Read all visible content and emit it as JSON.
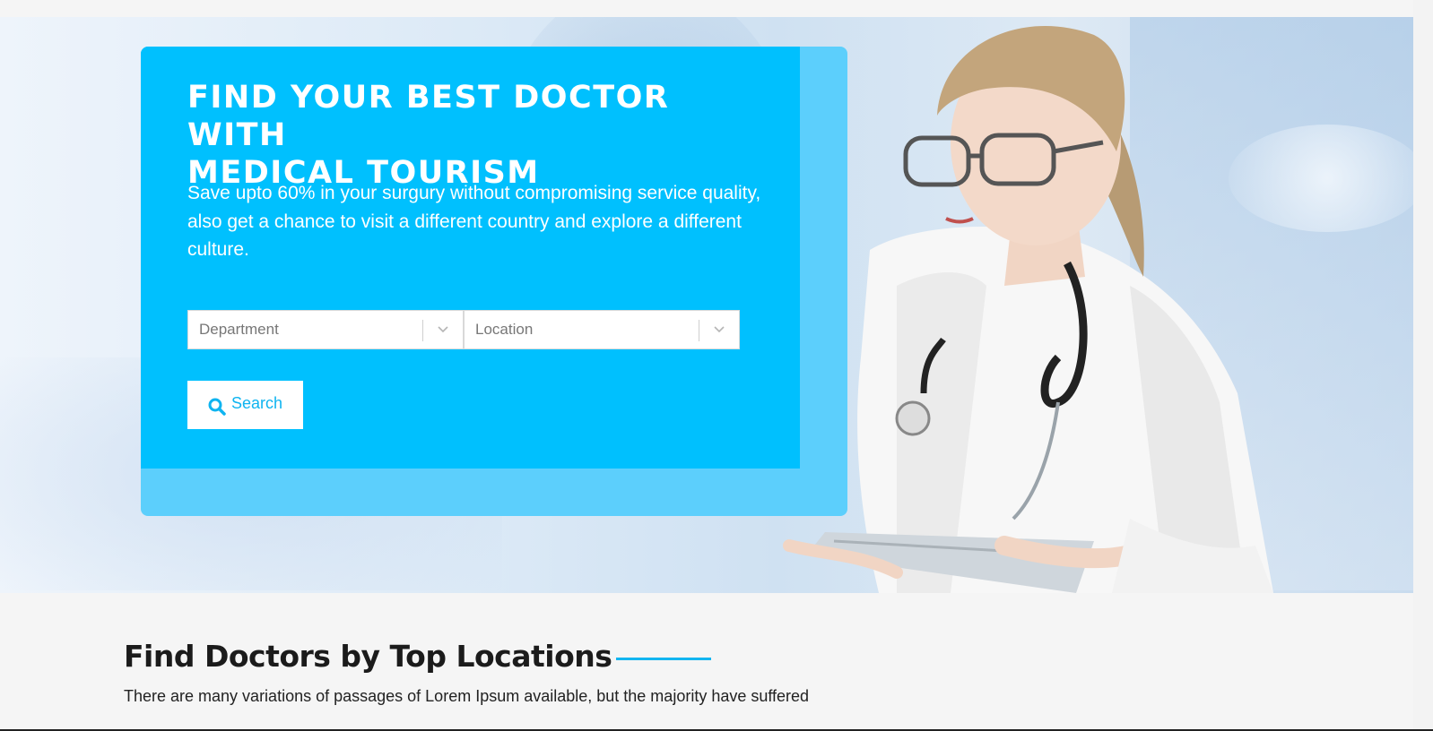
{
  "hero": {
    "headline_line1": "FIND YOUR BEST DOCTOR WITH",
    "headline_line2": "MEDICAL TOURISM",
    "lead_line1": "Save upto 60% in your surgury without compromising service quality,",
    "lead_line2": "also get a chance to visit a different country and explore a different culture.",
    "department_select": {
      "value": "Department",
      "icon": "chevron-down-icon"
    },
    "location_select": {
      "value": "Location",
      "icon": "chevron-down-icon"
    },
    "search_button": {
      "label": "Search",
      "icon": "search-icon"
    }
  },
  "section": {
    "title": "Find Doctors by Top Locations",
    "subtitle": "There are many variations of passages of Lorem Ipsum available, but the majority have suffered"
  },
  "colors": {
    "panel": "#00c0fe",
    "panel_outer": "#5ccffc",
    "accent_line": "#12b5f0",
    "button_text": "#0fb4f0"
  }
}
